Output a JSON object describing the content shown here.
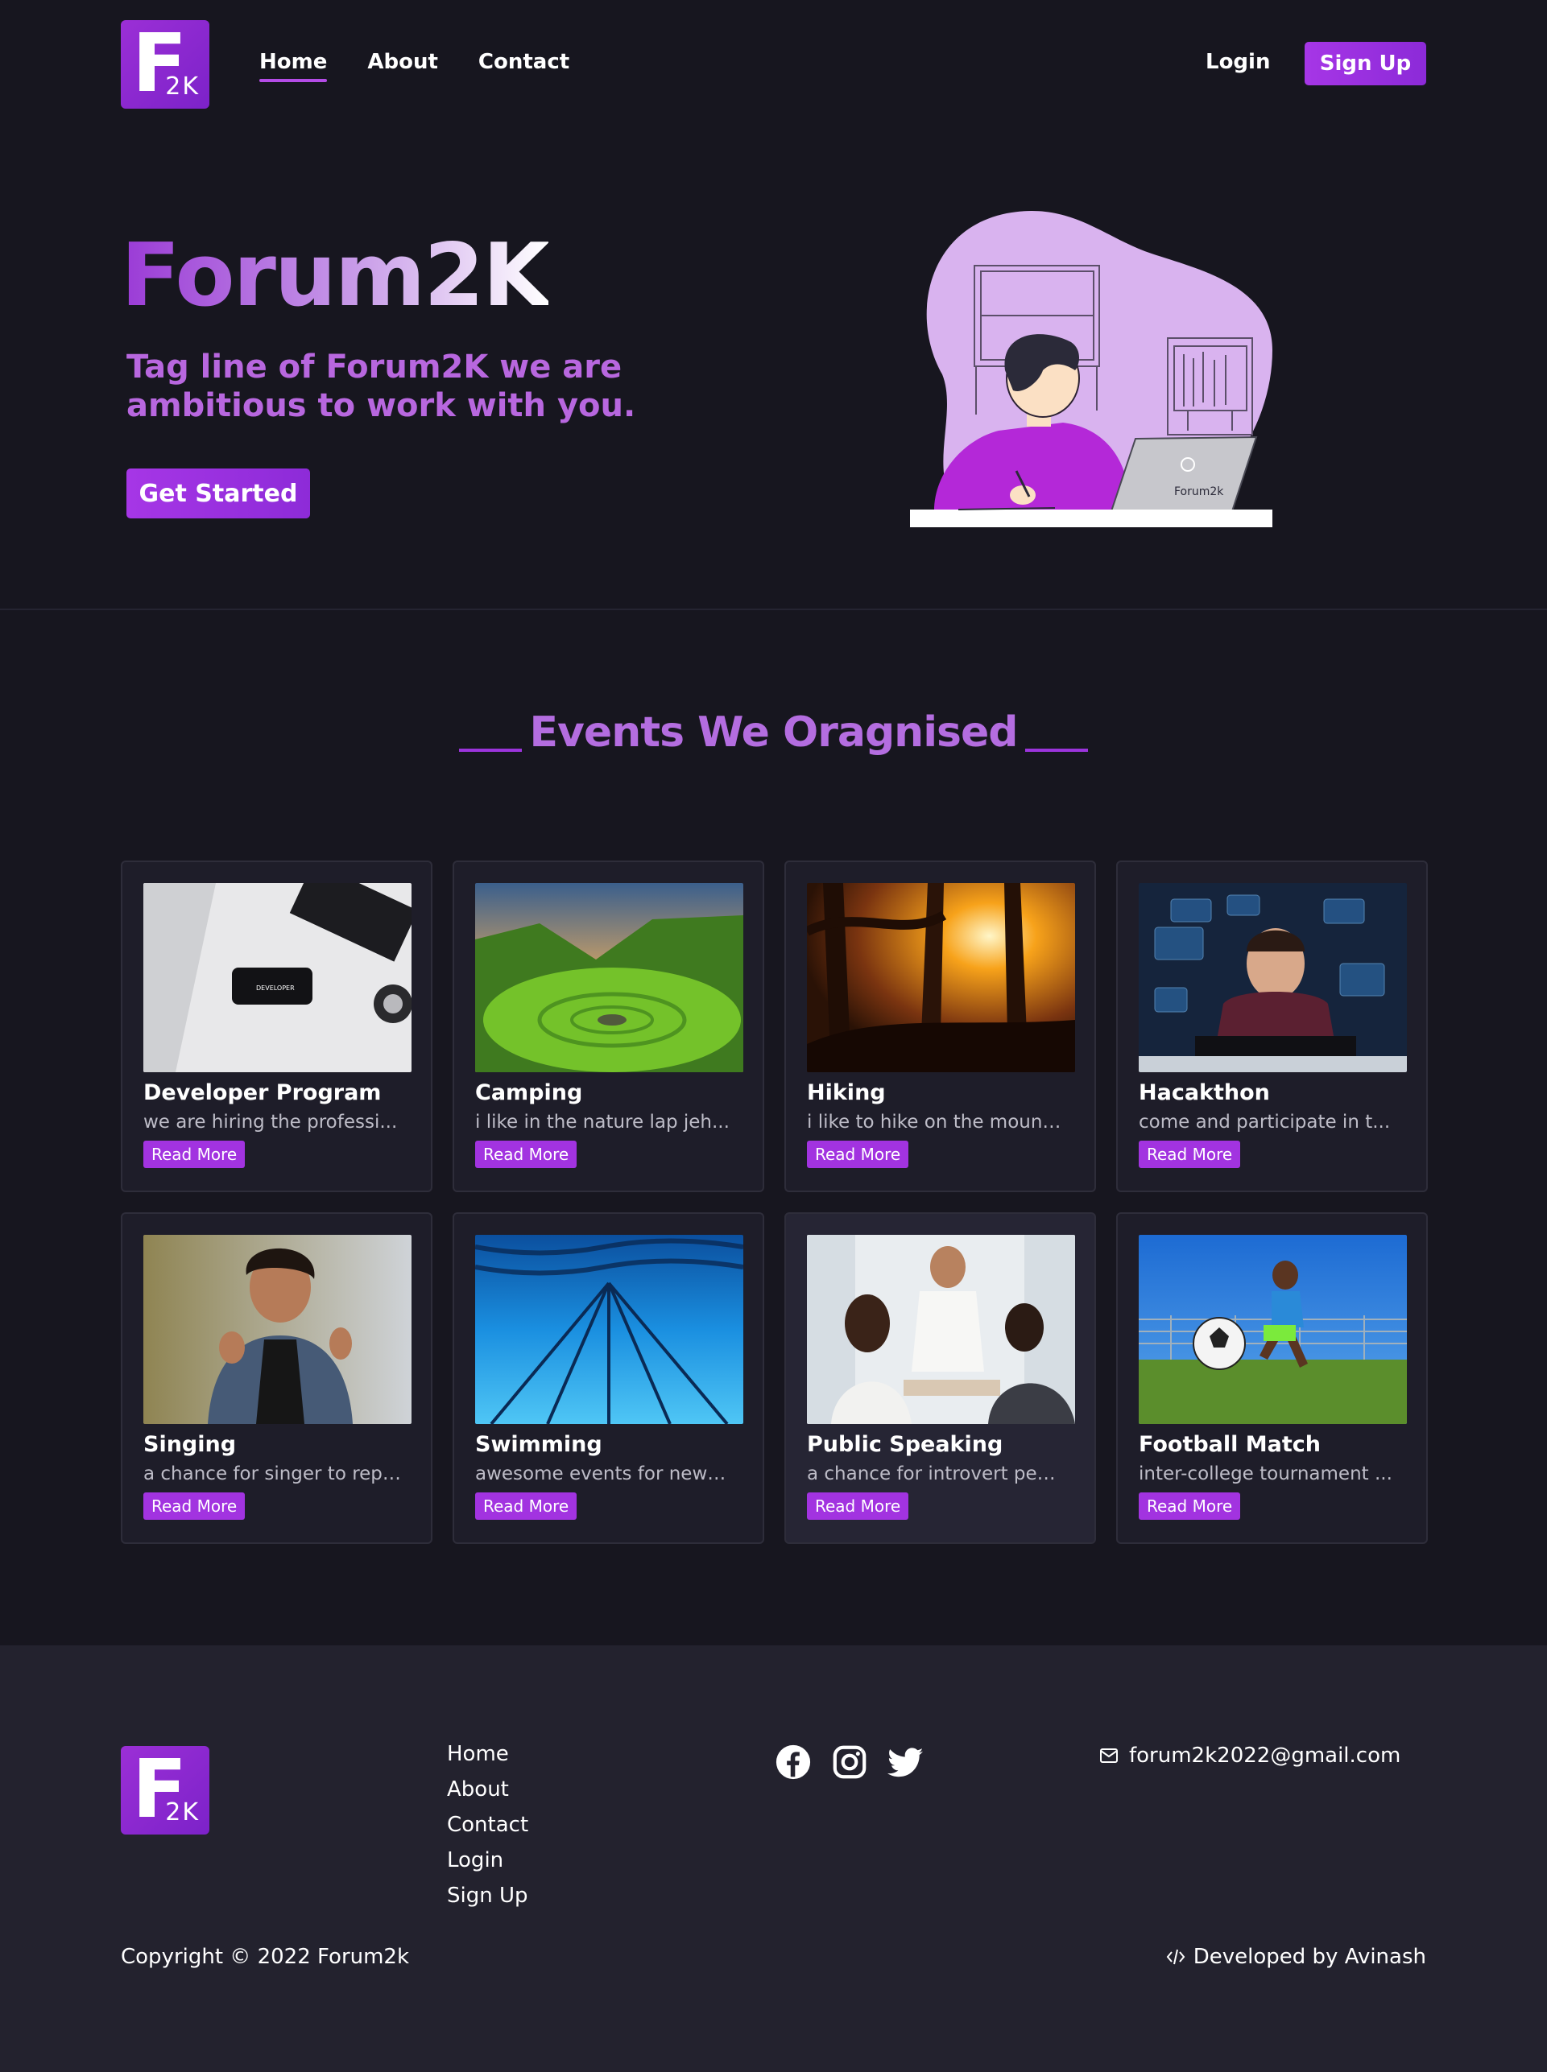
{
  "brand": {
    "logo_main": "F",
    "logo_sub": "2K"
  },
  "nav": {
    "links": [
      {
        "label": "Home",
        "active": true
      },
      {
        "label": "About"
      },
      {
        "label": "Contact"
      }
    ],
    "login": "Login",
    "signup": "Sign Up"
  },
  "hero": {
    "title": "Forum2K",
    "tagline": "Tag line of Forum2K we are ambitious to work with you.",
    "cta": "Get Started",
    "laptop_label": "Forum2k"
  },
  "events": {
    "title": "Events We Oragnised",
    "read_more": "Read More",
    "items": [
      {
        "title": "Developer Program",
        "desc": "we are hiring the professi...",
        "image": "developer-desk-image"
      },
      {
        "title": "Camping",
        "desc": "i like in the nature lap jeh...",
        "image": "green-valley-image"
      },
      {
        "title": "Hiking",
        "desc": "i like to hike on the mount...",
        "image": "sunset-forest-image"
      },
      {
        "title": "Hacakthon",
        "desc": "come and participate in t...",
        "image": "hacker-screens-image"
      },
      {
        "title": "Singing",
        "desc": "a chance for singer to repr...",
        "image": "singer-image"
      },
      {
        "title": "Swimming",
        "desc": "awesome events for newb...",
        "image": "pool-lanes-image"
      },
      {
        "title": "Public Speaking",
        "desc": "a chance for introvert peo...",
        "image": "meeting-image"
      },
      {
        "title": "Football Match",
        "desc": "inter-college tournament ...",
        "image": "football-kid-image"
      }
    ]
  },
  "footer": {
    "links": [
      "Home",
      "About",
      "Contact",
      "Login",
      "Sign Up"
    ],
    "socials": [
      "facebook-icon",
      "instagram-icon",
      "twitter-icon"
    ],
    "email": "forum2k2022@gmail.com",
    "copyright": "Copyright © 2022 Forum2k",
    "developer": "Developed by Avinash"
  },
  "colors": {
    "background": "#17161f",
    "footer_bg": "#23222e",
    "accent": "#a233e0",
    "heading_purple": "#b46de0"
  }
}
